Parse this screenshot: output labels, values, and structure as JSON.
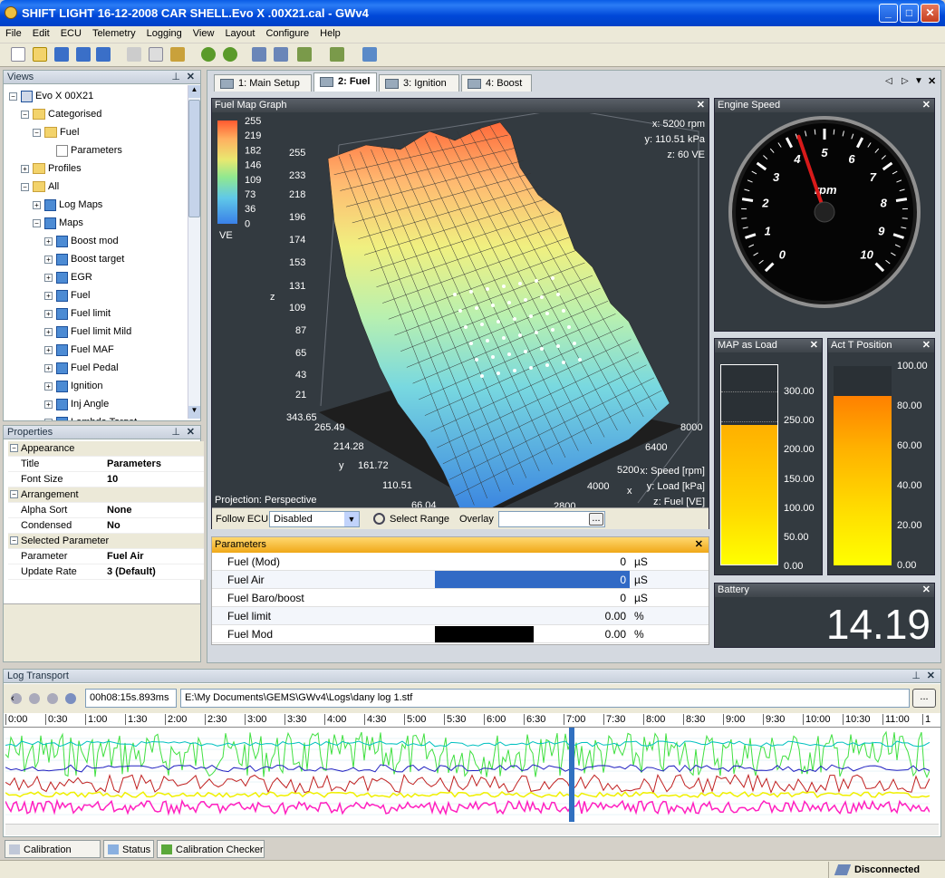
{
  "window": {
    "title": "SHIFT LIGHT 16-12-2008 CAR SHELL.Evo X   .00X21.cal - GWv4"
  },
  "menu": [
    "File",
    "Edit",
    "ECU",
    "Telemetry",
    "Logging",
    "View",
    "Layout",
    "Configure",
    "Help"
  ],
  "views": {
    "title": "Views",
    "tree": [
      {
        "label": "Evo X   00X21",
        "level": 0,
        "toggle": "−",
        "icon": "car-icon"
      },
      {
        "label": "Categorised",
        "level": 1,
        "toggle": "−",
        "icon": "folder-icon"
      },
      {
        "label": "Fuel",
        "level": 2,
        "toggle": "−",
        "icon": "folder-icon"
      },
      {
        "label": "Parameters",
        "level": 3,
        "toggle": "",
        "icon": "table-icon"
      },
      {
        "label": "Profiles",
        "level": 1,
        "toggle": "+",
        "icon": "folder-icon"
      },
      {
        "label": "All",
        "level": 1,
        "toggle": "−",
        "icon": "folder-icon"
      },
      {
        "label": "Log Maps",
        "level": 2,
        "toggle": "+",
        "icon": "map-icon"
      },
      {
        "label": "Maps",
        "level": 2,
        "toggle": "−",
        "icon": "map-icon"
      },
      {
        "label": "Boost mod",
        "level": 3,
        "toggle": "+",
        "icon": "map-icon"
      },
      {
        "label": "Boost target",
        "level": 3,
        "toggle": "+",
        "icon": "map-icon"
      },
      {
        "label": "EGR",
        "level": 3,
        "toggle": "+",
        "icon": "map-icon"
      },
      {
        "label": "Fuel",
        "level": 3,
        "toggle": "+",
        "icon": "map-icon"
      },
      {
        "label": "Fuel limit",
        "level": 3,
        "toggle": "+",
        "icon": "map-icon"
      },
      {
        "label": "Fuel limit Mild",
        "level": 3,
        "toggle": "+",
        "icon": "map-icon"
      },
      {
        "label": "Fuel MAF",
        "level": 3,
        "toggle": "+",
        "icon": "map-icon"
      },
      {
        "label": "Fuel Pedal",
        "level": 3,
        "toggle": "+",
        "icon": "map-icon"
      },
      {
        "label": "Ignition",
        "level": 3,
        "toggle": "+",
        "icon": "map-icon"
      },
      {
        "label": "Inj Angle",
        "level": 3,
        "toggle": "+",
        "icon": "map-icon"
      },
      {
        "label": "Lambda Target",
        "level": 3,
        "toggle": "+",
        "icon": "map-icon"
      }
    ]
  },
  "properties": {
    "title": "Properties",
    "rows": [
      {
        "cat": true,
        "k": "Appearance"
      },
      {
        "k": "Title",
        "v": "Parameters"
      },
      {
        "k": "Font Size",
        "v": "10"
      },
      {
        "cat": true,
        "k": "Arrangement"
      },
      {
        "k": "Alpha Sort",
        "v": "None"
      },
      {
        "k": "Condensed",
        "v": "No"
      },
      {
        "cat": true,
        "k": "Selected Parameter"
      },
      {
        "k": "Parameter",
        "v": "Fuel Air"
      },
      {
        "k": "Update Rate",
        "v": "3 (Default)"
      }
    ]
  },
  "tabs": [
    "1: Main Setup",
    "2: Fuel",
    "3: Ignition",
    "4: Boost"
  ],
  "active_tab": 1,
  "fuelmap": {
    "title": "Fuel Map Graph",
    "readout": [
      "x: 5200 rpm",
      "y: 110.51 kPa",
      "z: 60 VE"
    ],
    "legend_values": [
      "255",
      "219",
      "182",
      "146",
      "109",
      "73",
      "36",
      "0"
    ],
    "legend_unit": "VE",
    "z_ticks": [
      "255",
      "233",
      "218",
      "196",
      "174",
      "153",
      "131",
      "109",
      "87",
      "65",
      "43",
      "21",
      "343.65"
    ],
    "z_label": "z",
    "y_ticks": [
      "265.49",
      "214.28",
      "161.72",
      "110.51",
      "66.04"
    ],
    "y_label": "y",
    "x_ticks": [
      "8000",
      "6400",
      "5200",
      "4000",
      "2800"
    ],
    "x_label": "x",
    "axis_info": [
      "x: Speed [rpm]",
      "y: Load [kPa]",
      "z: Fuel [VE]"
    ],
    "projection": "Projection: Perspective",
    "follow_label": "Follow ECU",
    "follow_value": "Disabled",
    "select_range": "Select Range",
    "overlay_label": "Overlay",
    "browse": "..."
  },
  "parameters": {
    "title": "Parameters",
    "rows": [
      {
        "name": "Fuel (Mod)",
        "value": "0",
        "unit": "µS",
        "style": "plain"
      },
      {
        "name": "Fuel Air",
        "value": "0",
        "unit": "µS",
        "style": "selected"
      },
      {
        "name": "Fuel Baro/boost",
        "value": "0",
        "unit": "µS",
        "style": "plain"
      },
      {
        "name": "Fuel limit",
        "value": "0.00",
        "unit": "%",
        "style": "plain"
      },
      {
        "name": "Fuel Mod",
        "value": "0.00",
        "unit": "%",
        "style": "bar"
      }
    ]
  },
  "engine_speed": {
    "title": "Engine Speed",
    "unit": "rpm",
    "labels": [
      "0",
      "1",
      "2",
      "3",
      "4",
      "5",
      "6",
      "7",
      "8",
      "9",
      "10"
    ],
    "value": 4.3,
    "max": 10
  },
  "map_load": {
    "title": "MAP as Load",
    "ticks": [
      "300.00",
      "250.00",
      "200.00",
      "150.00",
      "100.00",
      "50.00",
      "0.00"
    ],
    "value": 238,
    "max": 340
  },
  "act_t": {
    "title": "Act T Position",
    "ticks": [
      "100.00",
      "80.00",
      "60.00",
      "40.00",
      "20.00",
      "0.00"
    ],
    "value": 85,
    "max": 100
  },
  "battery": {
    "title": "Battery",
    "value": "14.19"
  },
  "log": {
    "title": "Log Transport",
    "time": "00h08:15s.893ms",
    "path": "E:\\My Documents\\GEMS\\GWv4\\Logs\\dany log 1.stf",
    "browse": "...",
    "ticks": [
      "0:00",
      "0:30",
      "1:00",
      "1:30",
      "2:00",
      "2:30",
      "3:00",
      "3:30",
      "4:00",
      "4:30",
      "5:00",
      "5:30",
      "6:00",
      "6:30",
      "7:00",
      "7:30",
      "8:00",
      "8:30",
      "9:00",
      "9:30",
      "10:00",
      "10:30",
      "11:00",
      "1"
    ]
  },
  "bottom_tabs": [
    "Calibration Notes",
    "Status",
    "Calibration Checker"
  ],
  "status": "Disconnected",
  "colors": {
    "accent": "#0a5ce6",
    "orange": "#ffb000"
  }
}
